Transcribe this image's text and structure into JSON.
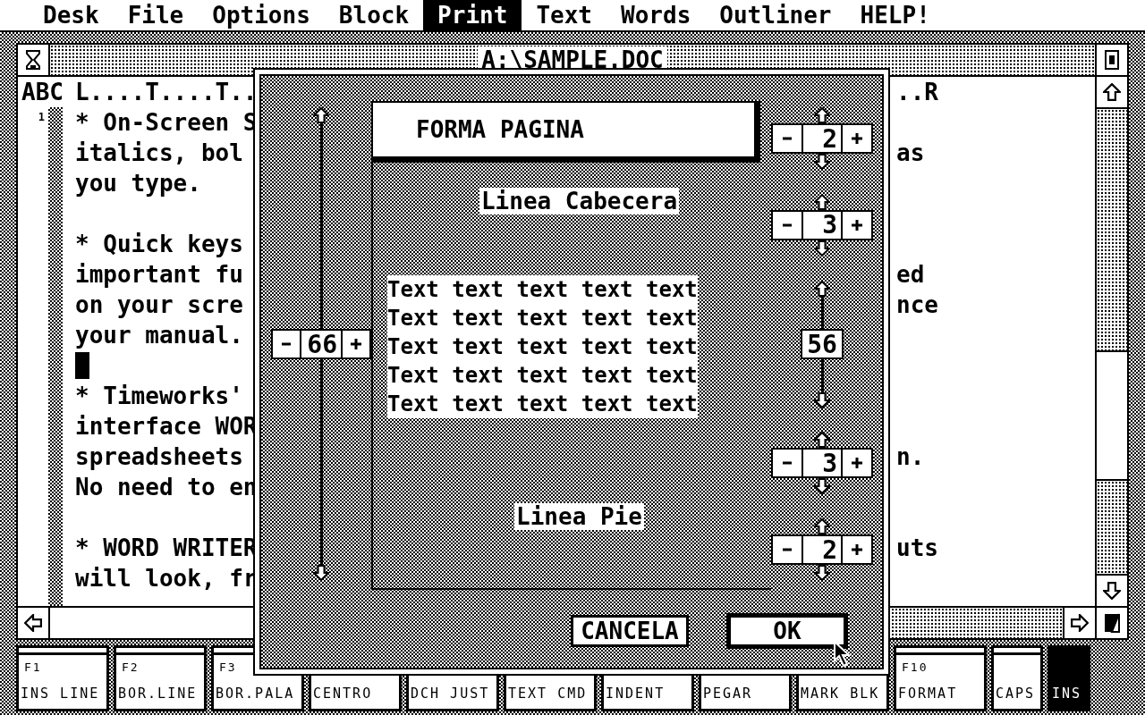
{
  "menu_bar": [
    {
      "label": "Desk",
      "selected": false
    },
    {
      "label": "File",
      "selected": false
    },
    {
      "label": "Options",
      "selected": false
    },
    {
      "label": "Block",
      "selected": false
    },
    {
      "label": "Print",
      "selected": true
    },
    {
      "label": "Text",
      "selected": false
    },
    {
      "label": "Words",
      "selected": false
    },
    {
      "label": "Outliner",
      "selected": false
    },
    {
      "label": "HELP!",
      "selected": false
    }
  ],
  "window": {
    "title": "A:\\SAMPLE.DOC",
    "ruler": {
      "label": "ABC",
      "left": "L....T....T..",
      "right": "..R"
    },
    "line_number": "1",
    "lines": [
      {
        "kind": "text",
        "left": "* On-Screen S"
      },
      {
        "kind": "text",
        "left": "italics, bol",
        "right": "as"
      },
      {
        "kind": "text",
        "left": "you type."
      },
      {
        "kind": "blank"
      },
      {
        "kind": "text",
        "left": "* Quick keys"
      },
      {
        "kind": "text",
        "left": "important fu",
        "right": "ed"
      },
      {
        "kind": "text",
        "left": "on your scre",
        "right": "nce"
      },
      {
        "kind": "text",
        "left": "your manual."
      },
      {
        "kind": "cursor"
      },
      {
        "kind": "text",
        "left": "* Timeworks'"
      },
      {
        "kind": "text",
        "left": "interface WOR"
      },
      {
        "kind": "text",
        "left": "spreadsheets",
        "right": "n."
      },
      {
        "kind": "text",
        "left": "No need to en"
      },
      {
        "kind": "blank"
      },
      {
        "kind": "text",
        "left": "* WORD WRITER",
        "right": "uts"
      },
      {
        "kind": "text",
        "left": "will look, fr"
      }
    ]
  },
  "dialog": {
    "title": "FORMA PAGINA",
    "page_length": "66",
    "header_label": "Linea Cabecera",
    "sample_lines": [
      "Text text text text text",
      "Text text text text text",
      "Text text text text text",
      "Text text text text text",
      "Text text text text text"
    ],
    "footer_label": "Linea Pie",
    "right_controls": [
      {
        "kind": "spinner",
        "value": "2"
      },
      {
        "kind": "spinner",
        "value": "3"
      },
      {
        "kind": "readout",
        "value": "56"
      },
      {
        "kind": "spinner",
        "value": "3"
      },
      {
        "kind": "spinner",
        "value": "2"
      }
    ],
    "buttons": [
      {
        "label": "CANCELA",
        "default": false
      },
      {
        "label": "OK",
        "default": true
      }
    ]
  },
  "function_keys": [
    {
      "kind": "fkey",
      "key": "F1",
      "label": "INS LINE"
    },
    {
      "kind": "fkey",
      "key": "F2",
      "label": "BOR.LINE"
    },
    {
      "kind": "fkey",
      "key": "F3",
      "label": "BOR.PALA"
    },
    {
      "kind": "fkey",
      "label": "CENTRO"
    },
    {
      "kind": "fkey",
      "label": "DCH JUST"
    },
    {
      "kind": "fkey",
      "label": "TEXT CMD"
    },
    {
      "kind": "fkey",
      "label": "INDENT"
    },
    {
      "kind": "fkey",
      "label": "PEGAR"
    },
    {
      "kind": "fkey",
      "label": "MARK BLK"
    },
    {
      "kind": "fkey",
      "key": "F10",
      "label": "FORMAT"
    },
    {
      "kind": "status",
      "label": "CAPS",
      "on": false
    },
    {
      "kind": "status",
      "label": "INS",
      "on": true
    }
  ]
}
